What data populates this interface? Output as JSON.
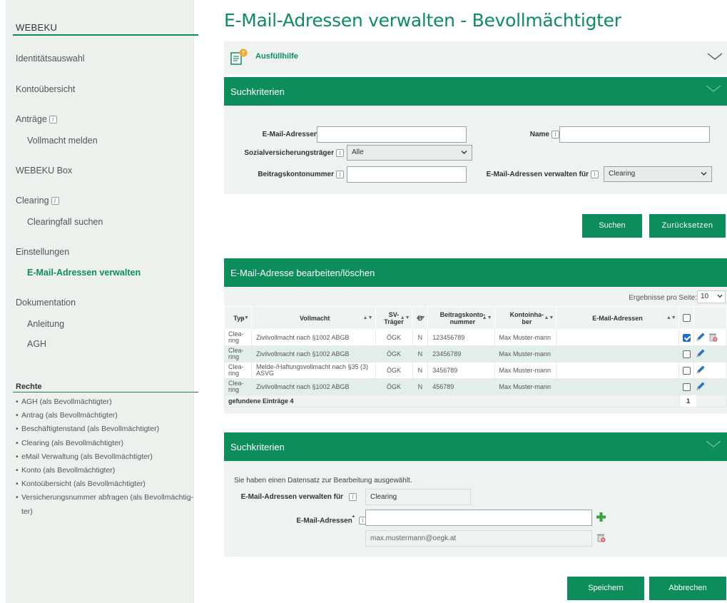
{
  "sidebar": {
    "title": "WEBEKU",
    "items": [
      {
        "label": "Identitätsauswahl"
      },
      {
        "label": "Kontoübersicht"
      },
      {
        "label": "Anträge"
      },
      {
        "label": "Vollmacht melden"
      },
      {
        "label": "WEBEKU Box"
      },
      {
        "label": "Clearing"
      },
      {
        "label": "Clearingfall suchen"
      },
      {
        "label": "Einstellungen"
      },
      {
        "label": "E-Mail-Adressen verwalten"
      },
      {
        "label": "Dokumentation"
      },
      {
        "label": "Anleitung"
      },
      {
        "label": "AGH"
      }
    ],
    "rechte_title": "Rechte",
    "rechte": [
      "AGH (als Bevollmächtigter)",
      "Antrag (als Bevollmächtigter)",
      "Beschäftigtenstand (als Bevollmächtigter)",
      "Clearing (als Bevollmächtigter)",
      "eMail Verwaltung (als Bevollmächtigter)",
      "Konto (als Bevollmächtigter)",
      "Kontoübersicht (als Bevollmächtigter)",
      "Versicherungsnummer abfragen (als Bevollmächtig-ter)"
    ]
  },
  "page_title": "E-Mail-Adressen verwalten - Bevollmächtigter",
  "help": {
    "label": "Ausfüllhilfe"
  },
  "search": {
    "title": "Suchkriterien",
    "email_label": "E-Mail-Adressen",
    "email_value": "",
    "name_label": "Name",
    "name_value": "",
    "sv_label": "Sozialversicherungsträger",
    "sv_value": "Alle",
    "konto_label": "Beitragskontonummer",
    "konto_value": "",
    "verwalten_label": "E-Mail-Adressen verwalten für",
    "verwalten_value": "Clearing",
    "btn_search": "Suchen",
    "btn_reset": "Zurücksetzen"
  },
  "results": {
    "title": "E-Mail-Adresse bearbeiten/löschen",
    "per_page_label": "Ergebnisse pro Seite:",
    "per_page_value": "10",
    "headers": {
      "typ": "Typ",
      "vollmacht": "Vollmacht",
      "sv": "SV-Träger",
      "b": "B",
      "konto": "Beitragskonto-nummer",
      "inhaber": "Kontoinha-ber",
      "emails": "E-Mail-Adressen"
    },
    "rows": [
      {
        "typ": "Clea-ring",
        "vollmacht": "Zivilvollmacht nach §1002 ABGB",
        "sv": "ÖGK",
        "b": "N",
        "konto": "123456789",
        "inhaber": "Max Muster-mann",
        "email": "",
        "checked": true,
        "deletable": true
      },
      {
        "typ": "Clea-ring",
        "vollmacht": "Zivilvollmacht nach §1002 ABGB",
        "sv": "ÖGK",
        "b": "N",
        "konto": "23456789",
        "inhaber": "Max Muster-mann",
        "email": "",
        "checked": false,
        "deletable": false
      },
      {
        "typ": "Clea-ring",
        "vollmacht": "Melde-/Haftungsvollmacht nach §35 (3) ASVG",
        "sv": "ÖGK",
        "b": "N",
        "konto": "3456789",
        "inhaber": "Max Muster-mann",
        "email": "",
        "checked": false,
        "deletable": false
      },
      {
        "typ": "Clea-ring",
        "vollmacht": "Zivilvollmacht nach §1002 ABGB",
        "sv": "ÖGK",
        "b": "N",
        "konto": "456789",
        "inhaber": "Max Muster-mann",
        "email": "",
        "checked": false,
        "deletable": false
      }
    ],
    "found_label": "gefundene Einträge 4",
    "page": "1"
  },
  "edit": {
    "title": "Suchkriterien",
    "notice": "Sie haben einen Datensatz zur Bearbeitung ausgewählt.",
    "verwalten_label": "E-Mail-Adressen verwalten für",
    "verwalten_value": "Clearing",
    "email_label": "E-Mail-Adressen",
    "required_mark": "*",
    "new_email_value": "",
    "existing_email": "max.mustermann@oegk.at",
    "btn_save": "Speichern",
    "btn_cancel": "Abbrechen"
  },
  "colors": {
    "brand": "#0d8d5b",
    "panel_bg": "#eef2f0",
    "sidebar_bg": "#ecf1ee",
    "row_alt": "#e3eee9"
  },
  "icons": [
    "help-document-icon",
    "chevron-down-icon",
    "info-icon",
    "edit-pencil-icon",
    "delete-bin-icon",
    "add-plus-icon"
  ]
}
